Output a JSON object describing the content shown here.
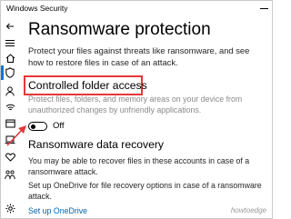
{
  "window": {
    "title": "Windows Security"
  },
  "sidebar": {
    "items": [
      {
        "icon": "back-arrow-icon"
      },
      {
        "icon": "hamburger-menu-icon"
      },
      {
        "icon": "home-icon"
      },
      {
        "icon": "shield-icon"
      },
      {
        "icon": "person-icon"
      },
      {
        "icon": "wifi-signal-icon"
      },
      {
        "icon": "app-browser-icon"
      },
      {
        "icon": "laptop-icon"
      },
      {
        "icon": "heart-icon"
      },
      {
        "icon": "family-icon"
      },
      {
        "icon": "gear-icon"
      }
    ]
  },
  "page": {
    "title": "Ransomware protection",
    "intro": "Protect your files against threats like ransomware, and see how to restore files in case of an attack."
  },
  "controlled_folder_access": {
    "title": "Controlled folder access",
    "description": "Protect files, folders, and memory areas on your device from unauthorized changes by unfriendly applications.",
    "toggle_state": "Off"
  },
  "ransomware_data_recovery": {
    "title": "Ransomware data recovery",
    "description": "You may be able to recover files in these accounts in case of a ransomware attack.",
    "onedrive_text": "Set up OneDrive for file recovery options in case of a ransomware attack.",
    "onedrive_link": "Set up OneDrive"
  },
  "colors": {
    "accent": "#0078d7",
    "highlight_box": "#e5383b",
    "link": "#0063b1"
  },
  "watermark": "howtoedge"
}
